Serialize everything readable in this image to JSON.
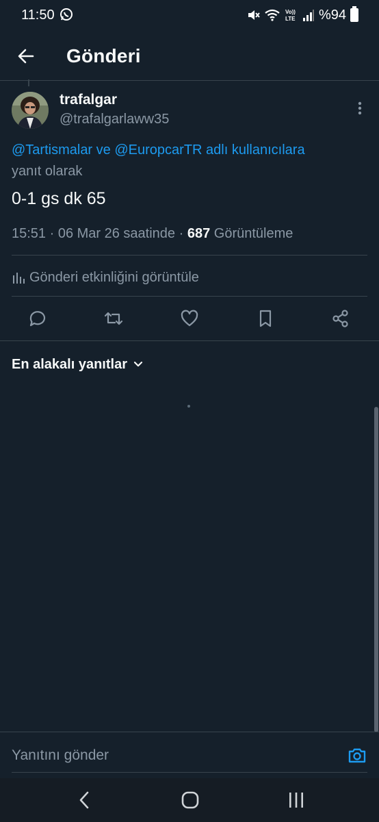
{
  "status_bar": {
    "time": "11:50",
    "battery": "%94",
    "icons": [
      "whatsapp-icon",
      "mute-icon",
      "wifi-icon",
      "volte-icon",
      "signal-icon",
      "battery-icon"
    ]
  },
  "header": {
    "title": "Gönderi",
    "back_icon": "arrow-left-icon"
  },
  "post": {
    "display_name": "trafalgar",
    "handle": "@trafalgarlaww35",
    "reply_mention_1": "@Tartismalar",
    "reply_connector": " ve ",
    "reply_mention_2": "@EuropcarTR",
    "reply_suffix": " adlı kullanıcılara",
    "reply_suffix_2": "yanıt olarak",
    "text": "0-1 gs dk 65",
    "timestamp": "15:51 · 06 Mar 26 saatinde · ",
    "views_count": "687",
    "views_label": " Görüntüleme",
    "activity_label": "Gönderi etkinliğini görüntüle"
  },
  "actions": [
    "reply-icon",
    "repost-icon",
    "like-icon",
    "bookmark-icon",
    "share-icon"
  ],
  "replies": {
    "sort_label": "En alakalı yanıtlar"
  },
  "reply_bar": {
    "placeholder": "Yanıtını gönder"
  },
  "colors": {
    "background": "#15202b",
    "accent": "#1d9bf0",
    "muted_text": "#8b98a5",
    "divider": "#38444d"
  }
}
